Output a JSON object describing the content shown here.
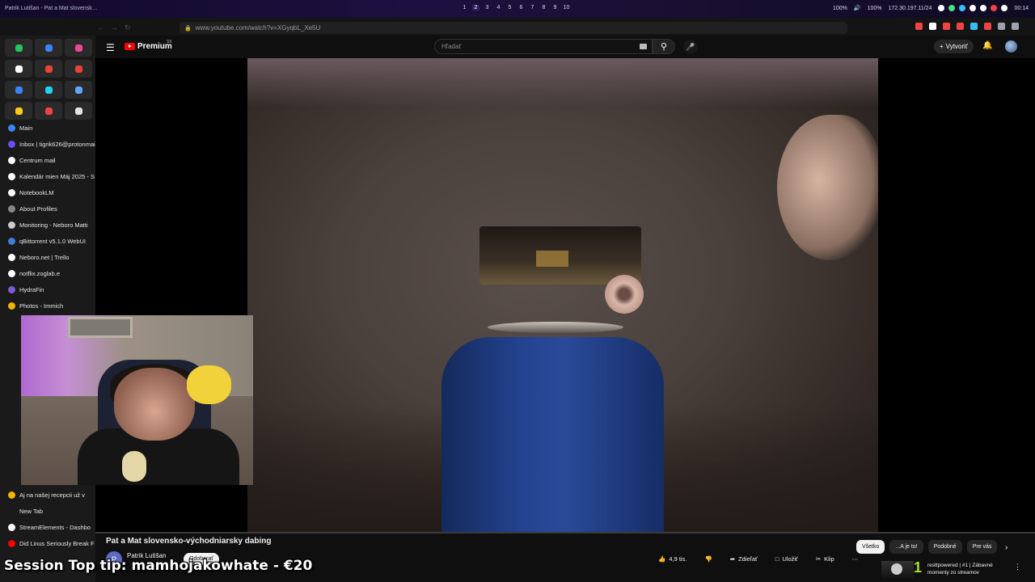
{
  "sysbar": {
    "window_title": "Patrik Lutišan - Pat a Mat slovensk…",
    "workspaces": [
      "1",
      "2",
      "3",
      "4",
      "5",
      "6",
      "7",
      "8",
      "9",
      "10"
    ],
    "active_workspace": 1,
    "status_left": "100%",
    "status_volume": "100%",
    "ip": "172.30.197.11/24",
    "clock": "00:14"
  },
  "browser": {
    "url": "www.youtube.com/watch?v=XGyqbL_Xe5U"
  },
  "sidebar": {
    "tabs": [
      {
        "label": "Main",
        "color": "#3b82f6"
      },
      {
        "label": "Inbox | tigrik626@protonmail",
        "color": "#6d4aff"
      },
      {
        "label": "Centrum mail",
        "color": "#ffffff"
      },
      {
        "label": "Kalendár mien Máj 2025 - S",
        "color": "#ffffff"
      },
      {
        "label": "NotebookLM",
        "color": "#ffffff"
      },
      {
        "label": "About Profiles",
        "color": "#888888"
      },
      {
        "label": "Monitoring - Neboro Matti",
        "color": "#cccccc"
      },
      {
        "label": "qBittorrent v5.1.0 WebUI",
        "color": "#3f7ddb"
      },
      {
        "label": "Neboro.net | Trello",
        "color": "#ffffff"
      },
      {
        "label": "notflix.zoglab.e",
        "color": "#ffffff"
      },
      {
        "label": "HydraFin",
        "color": "#7b5cd6"
      },
      {
        "label": "Photos - Immich",
        "color": "#f5b301"
      }
    ],
    "tabs_bottom": [
      {
        "label": "Aj na našej recepcii už v",
        "color": "#f5b301"
      },
      {
        "label": "New Tab",
        "color": "#1a1a1a"
      },
      {
        "label": "StreamElements - Dashbo",
        "color": "#ffffff"
      },
      {
        "label": "Did Linus Seriously Break F",
        "color": "#ff0000"
      }
    ],
    "pinned_colors": [
      "#22c55e",
      "#3b82f6",
      "#ec4899",
      "#ffffff",
      "#ea4335",
      "#ea4335",
      "#3b82f6",
      "#22d3ee",
      "#60a5fa",
      "#facc15",
      "#ef4444",
      "#e5e5e5"
    ]
  },
  "youtube": {
    "logo_text": "Premium",
    "region": "SK",
    "search_placeholder": "Hľadať",
    "create_label": "Vytvoriť",
    "video_title": "Pat a Mat slovensko-východniarsky dabing",
    "channel_initial": "P",
    "channel_name": "Patrik Lutišan",
    "subscribe_label": "Odoberať",
    "actions": {
      "likes": "4,9 tis.",
      "share": "Zdieľať",
      "save": "Uložiť",
      "clip": "Klip"
    },
    "chips": [
      "Všetko",
      "...A je to!",
      "Podobné",
      "Pre vás"
    ],
    "suggestion": {
      "rank": "1",
      "title": "resttpowered | #1 | Zábavné momenty zo streamov"
    }
  },
  "overlay": {
    "tip_text": "Session Top tip: mamhojakowhate - €20"
  }
}
